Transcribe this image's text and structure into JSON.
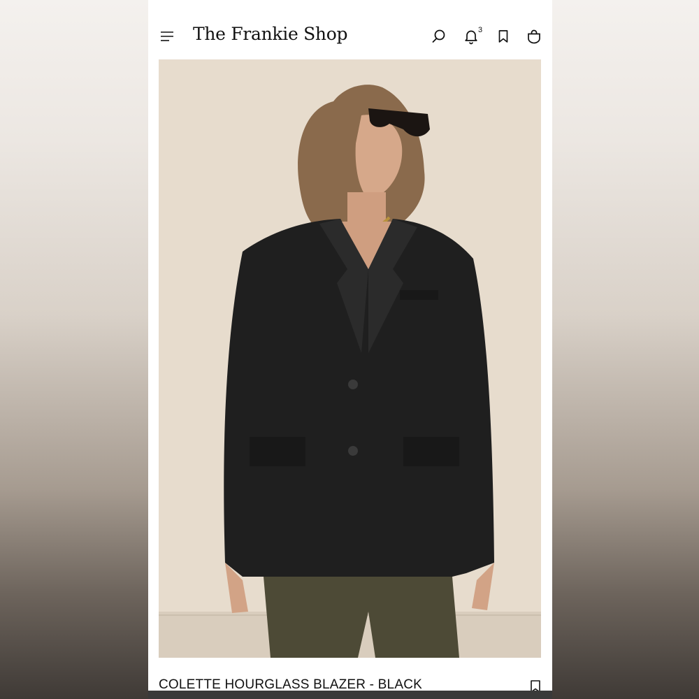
{
  "header": {
    "brand": "The Frankie Shop",
    "notification_count": "3",
    "icons": {
      "menu": "menu-icon",
      "search": "search-icon",
      "notifications": "bell-icon",
      "saved": "bookmark-icon",
      "cart": "shopping-bag-icon"
    }
  },
  "product": {
    "title": "COLETTE HOURGLASS BLAZER - BLACK",
    "image_alt": "model wearing black hourglass blazer"
  },
  "colors": {
    "background": "#ffffff",
    "text": "#111111",
    "image_wall": "#e6dacb",
    "blazer": "#1f1f1f",
    "trousers": "#4d4a36"
  }
}
